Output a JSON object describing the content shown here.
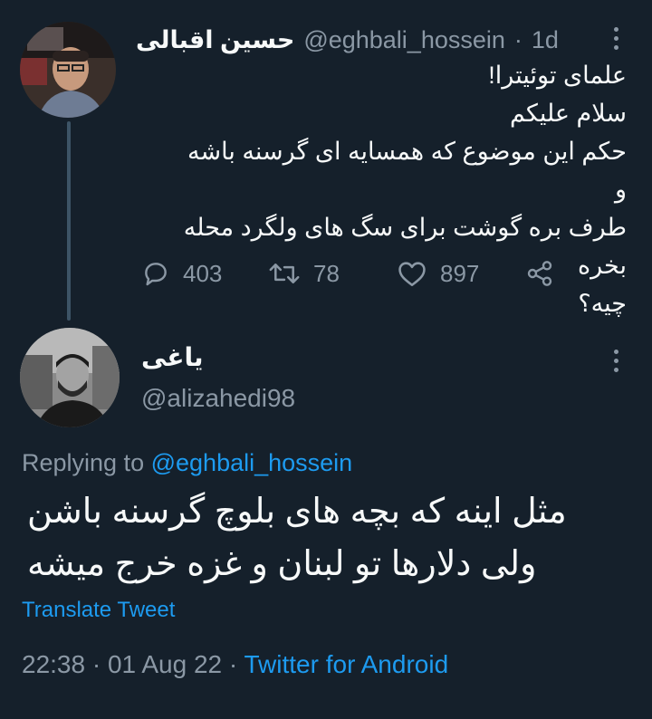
{
  "parent_tweet": {
    "display_name": "حسین اقبالی",
    "handle": "@eghbali_hossein",
    "separator": "·",
    "time_ago": "1d",
    "text_lines": [
      "علمای توئیترا!",
      "سلام علیکم",
      "حکم این موضوع که همسایه ای گرسنه باشه و",
      "طرف بره گوشت برای سگ های ولگرد محله  بخره",
      "چیه؟"
    ],
    "actions": {
      "reply_count": "403",
      "retweet_count": "78",
      "like_count": "897"
    }
  },
  "reply_tweet": {
    "display_name": "یاغی",
    "handle": "@alizahedi98",
    "replying_prefix": "Replying to",
    "replying_to": "@eghbali_hossein",
    "text_lines": [
      "مثل اینه که بچه های بلوچ گرسنه باشن",
      "ولی دلارها تو لبنان و غزه خرج میشه"
    ],
    "translate_label": "Translate Tweet",
    "time": "22:38",
    "date": "01 Aug 22",
    "dot": "·",
    "source": "Twitter for Android"
  },
  "colors": {
    "background": "#15202b",
    "text": "#f7f9f9",
    "muted": "#8b98a5",
    "link": "#1d9bf0",
    "thread_line": "#3d5466"
  },
  "icons": {
    "reply": "speech-bubble-icon",
    "retweet": "retweet-icon",
    "like": "heart-icon",
    "share": "share-icon",
    "more": "vertical-dots-icon"
  }
}
